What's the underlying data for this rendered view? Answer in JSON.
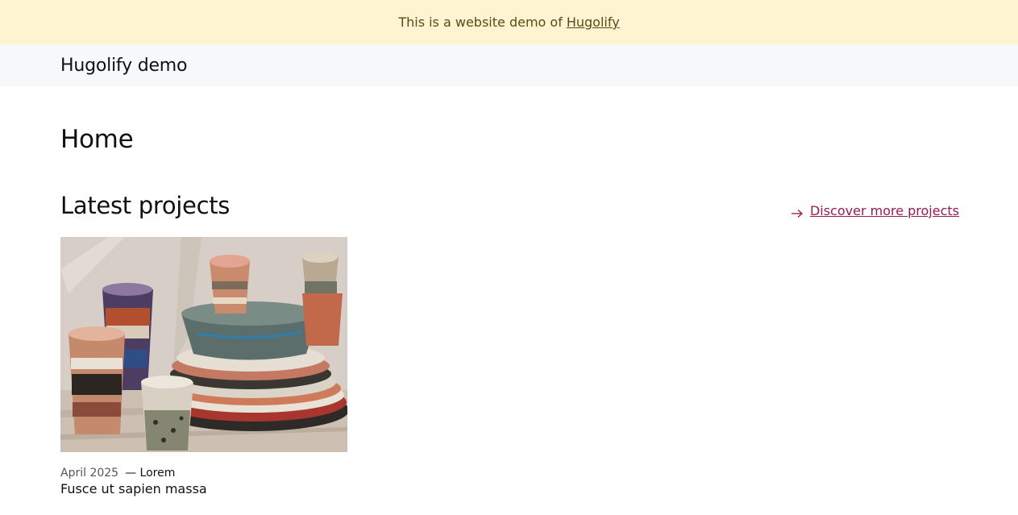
{
  "banner": {
    "text": "This is a website demo of",
    "link": "Hugolify"
  },
  "header": {
    "site_title": "Hugolify demo"
  },
  "page": {
    "title": "Home"
  },
  "projects": {
    "heading": "Latest projects",
    "more_link": "Discover more projects",
    "items": [
      {
        "date": "April 2025",
        "category": "— Lorem",
        "title": "Fusce ut sapien massa",
        "image": "stacked-ceramic-cups-and-plates"
      }
    ]
  },
  "colors": {
    "banner_bg": "#fff4d1",
    "header_bg": "#f6f8fa",
    "accent": "#9b1a4e"
  },
  "icons": {
    "more_link": "arrow-right-icon"
  }
}
